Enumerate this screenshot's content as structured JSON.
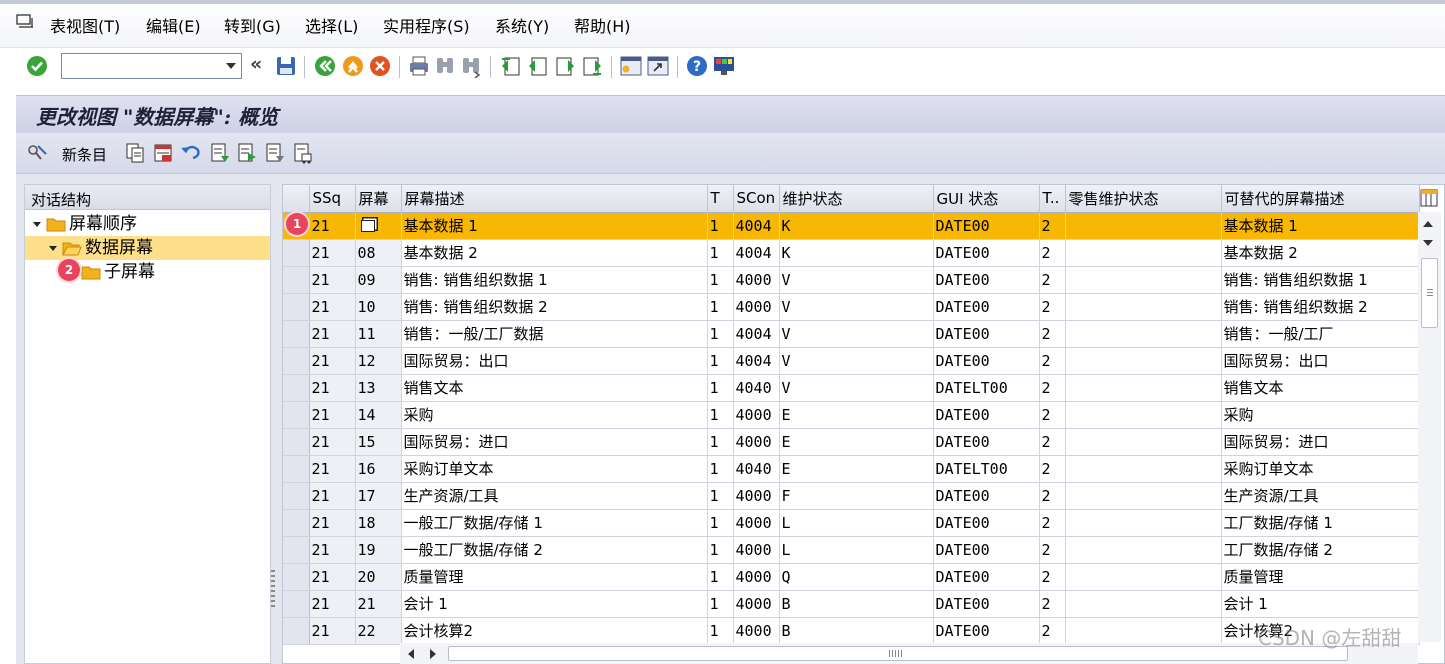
{
  "menu": {
    "items": [
      "表视图(T)",
      "编辑(E)",
      "转到(G)",
      "选择(L)",
      "实用程序(S)",
      "系统(Y)",
      "帮助(H)"
    ]
  },
  "toolbar": {
    "command_value": "",
    "icons": [
      "check-icon",
      "back-icon",
      "save-icon",
      "back-green-icon",
      "exit-icon",
      "cancel-icon",
      "print-icon",
      "find-icon",
      "find-next-icon",
      "first-page-icon",
      "prev-page-icon",
      "next-page-icon",
      "last-page-icon",
      "create-session-icon",
      "shortcut-icon",
      "help-icon",
      "customize-icon"
    ]
  },
  "title": "更改视图 \"数据屏幕\": 概览",
  "app_toolbar": {
    "new_entries": "新条目"
  },
  "tree": {
    "header": "对话结构",
    "nodes": [
      {
        "label": "屏幕顺序",
        "level": 0
      },
      {
        "label": "数据屏幕",
        "level": 1,
        "selected": true
      },
      {
        "label": "子屏幕",
        "level": 2
      }
    ]
  },
  "badges": [
    "1",
    "2"
  ],
  "table": {
    "columns": [
      "SSq",
      "屏幕",
      "屏幕描述",
      "T",
      "SCon",
      "维护状态",
      "GUI 状态",
      "T..",
      "零售维护状态",
      "可替代的屏幕描述"
    ],
    "rows": [
      [
        "21",
        "",
        "基本数据 1",
        "1",
        "4004",
        "K",
        "DATE00",
        "2",
        "",
        "基本数据 1"
      ],
      [
        "21",
        "08",
        "基本数据 2",
        "1",
        "4004",
        "K",
        "DATE00",
        "2",
        "",
        "基本数据 2"
      ],
      [
        "21",
        "09",
        "销售: 销售组织数据 1",
        "1",
        "4000",
        "V",
        "DATE00",
        "2",
        "",
        "销售: 销售组织数据 1"
      ],
      [
        "21",
        "10",
        "销售: 销售组织数据 2",
        "1",
        "4000",
        "V",
        "DATE00",
        "2",
        "",
        "销售: 销售组织数据 2"
      ],
      [
        "21",
        "11",
        "销售：一般/工厂数据",
        "1",
        "4004",
        "V",
        "DATE00",
        "2",
        "",
        "销售：一般/工厂"
      ],
      [
        "21",
        "12",
        "国际贸易：出口",
        "1",
        "4004",
        "V",
        "DATE00",
        "2",
        "",
        "国际贸易：出口"
      ],
      [
        "21",
        "13",
        "销售文本",
        "1",
        "4040",
        "V",
        "DATELT00",
        "2",
        "",
        "销售文本"
      ],
      [
        "21",
        "14",
        "采购",
        "1",
        "4000",
        "E",
        "DATE00",
        "2",
        "",
        "采购"
      ],
      [
        "21",
        "15",
        "国际贸易：进口",
        "1",
        "4000",
        "E",
        "DATE00",
        "2",
        "",
        "国际贸易：进口"
      ],
      [
        "21",
        "16",
        "采购订单文本",
        "1",
        "4040",
        "E",
        "DATELT00",
        "2",
        "",
        "采购订单文本"
      ],
      [
        "21",
        "17",
        "生产资源/工具",
        "1",
        "4000",
        "F",
        "DATE00",
        "2",
        "",
        "生产资源/工具"
      ],
      [
        "21",
        "18",
        "一般工厂数据/存储 1",
        "1",
        "4000",
        "L",
        "DATE00",
        "2",
        "",
        "工厂数据/存储 1"
      ],
      [
        "21",
        "19",
        "一般工厂数据/存储 2",
        "1",
        "4000",
        "L",
        "DATE00",
        "2",
        "",
        "工厂数据/存储 2"
      ],
      [
        "21",
        "20",
        "质量管理",
        "1",
        "4000",
        "Q",
        "DATE00",
        "2",
        "",
        "质量管理"
      ],
      [
        "21",
        "21",
        "会计 1",
        "1",
        "4000",
        "B",
        "DATE00",
        "2",
        "",
        "会计 1"
      ],
      [
        "21",
        "22",
        "会计核算2",
        "1",
        "4000",
        "B",
        "DATE00",
        "2",
        "",
        "会计核算2"
      ]
    ],
    "highlighted_row": 0
  },
  "watermark": "CSDN @左甜甜",
  "colors": {
    "highlight": "#f8b700",
    "tree_selected": "#ffe08a",
    "title_bg": "#d6d9ea",
    "badge": "#e8445c"
  }
}
